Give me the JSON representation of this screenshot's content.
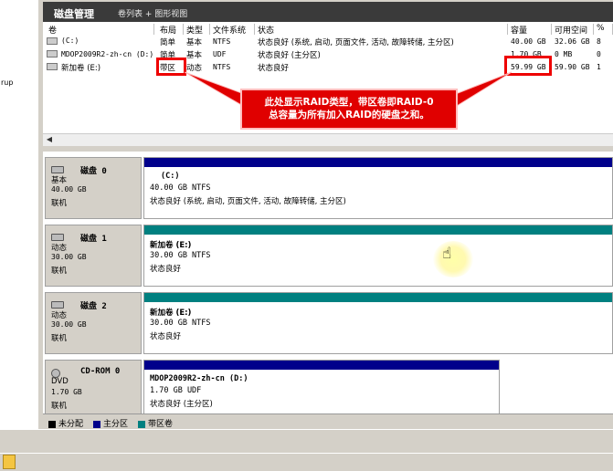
{
  "left_pane": {
    "tree_text": "rup"
  },
  "header": {
    "title": "磁盘管理",
    "breadcrumb": "卷列表 + 图形视图"
  },
  "columns": [
    {
      "label": "卷"
    },
    {
      "label": "布局"
    },
    {
      "label": "类型"
    },
    {
      "label": "文件系统"
    },
    {
      "label": "状态"
    },
    {
      "label": "容量"
    },
    {
      "label": "可用空间"
    },
    {
      "label": "%"
    }
  ],
  "volumes": [
    {
      "name": "(C:)",
      "layout": "简单",
      "type": "基本",
      "fs": "NTFS",
      "status": "状态良好 (系统, 启动, 页面文件, 活动, 故障转储, 主分区)",
      "capacity": "40.00 GB",
      "free": "32.06 GB",
      "pct": "8"
    },
    {
      "name": "MDOP2009R2-zh-cn (D:)",
      "layout": "简单",
      "type": "基本",
      "fs": "UDF",
      "status": "状态良好 (主分区)",
      "capacity": "1.70 GB",
      "free": "0 MB",
      "pct": "0"
    },
    {
      "name": "新加卷 (E:)",
      "layout": "带区",
      "type": "动态",
      "fs": "NTFS",
      "status": "状态良好",
      "capacity": "59.99 GB",
      "free": "59.90 GB",
      "pct": "1"
    }
  ],
  "callout": {
    "line1": "此处显示RAID类型，带区卷即RAID-0",
    "line2": "总容量为所有加入RAID的硬盘之和。"
  },
  "disks": [
    {
      "name": "磁盘 0",
      "type": "基本",
      "size": "40.00 GB",
      "state": "联机",
      "part": {
        "title": "(C:)",
        "size": "40.00 GB NTFS",
        "status": "状态良好 (系统, 启动, 页面文件, 活动, 故障转储, 主分区)"
      }
    },
    {
      "name": "磁盘 1",
      "type": "动态",
      "size": "30.00 GB",
      "state": "联机",
      "part": {
        "title": "新加卷  (E:)",
        "size": "30.00 GB NTFS",
        "status": "状态良好"
      }
    },
    {
      "name": "磁盘 2",
      "type": "动态",
      "size": "30.00 GB",
      "state": "联机",
      "part": {
        "title": "新加卷  (E:)",
        "size": "30.00 GB NTFS",
        "status": "状态良好"
      }
    },
    {
      "name": "CD-ROM 0",
      "type": "DVD",
      "size": "1.70 GB",
      "state": "联机",
      "part": {
        "title": "MDOP2009R2-zh-cn  (D:)",
        "size": "1.70 GB UDF",
        "status": "状态良好 (主分区)"
      }
    }
  ],
  "legend": [
    {
      "label": "未分配",
      "color": "#000000"
    },
    {
      "label": "主分区",
      "color": "#00008b"
    },
    {
      "label": "带区卷",
      "color": "#008080"
    }
  ],
  "colors": {
    "highlight": "#e00000",
    "primary_band": "#00008b",
    "striped_band": "#008080"
  }
}
